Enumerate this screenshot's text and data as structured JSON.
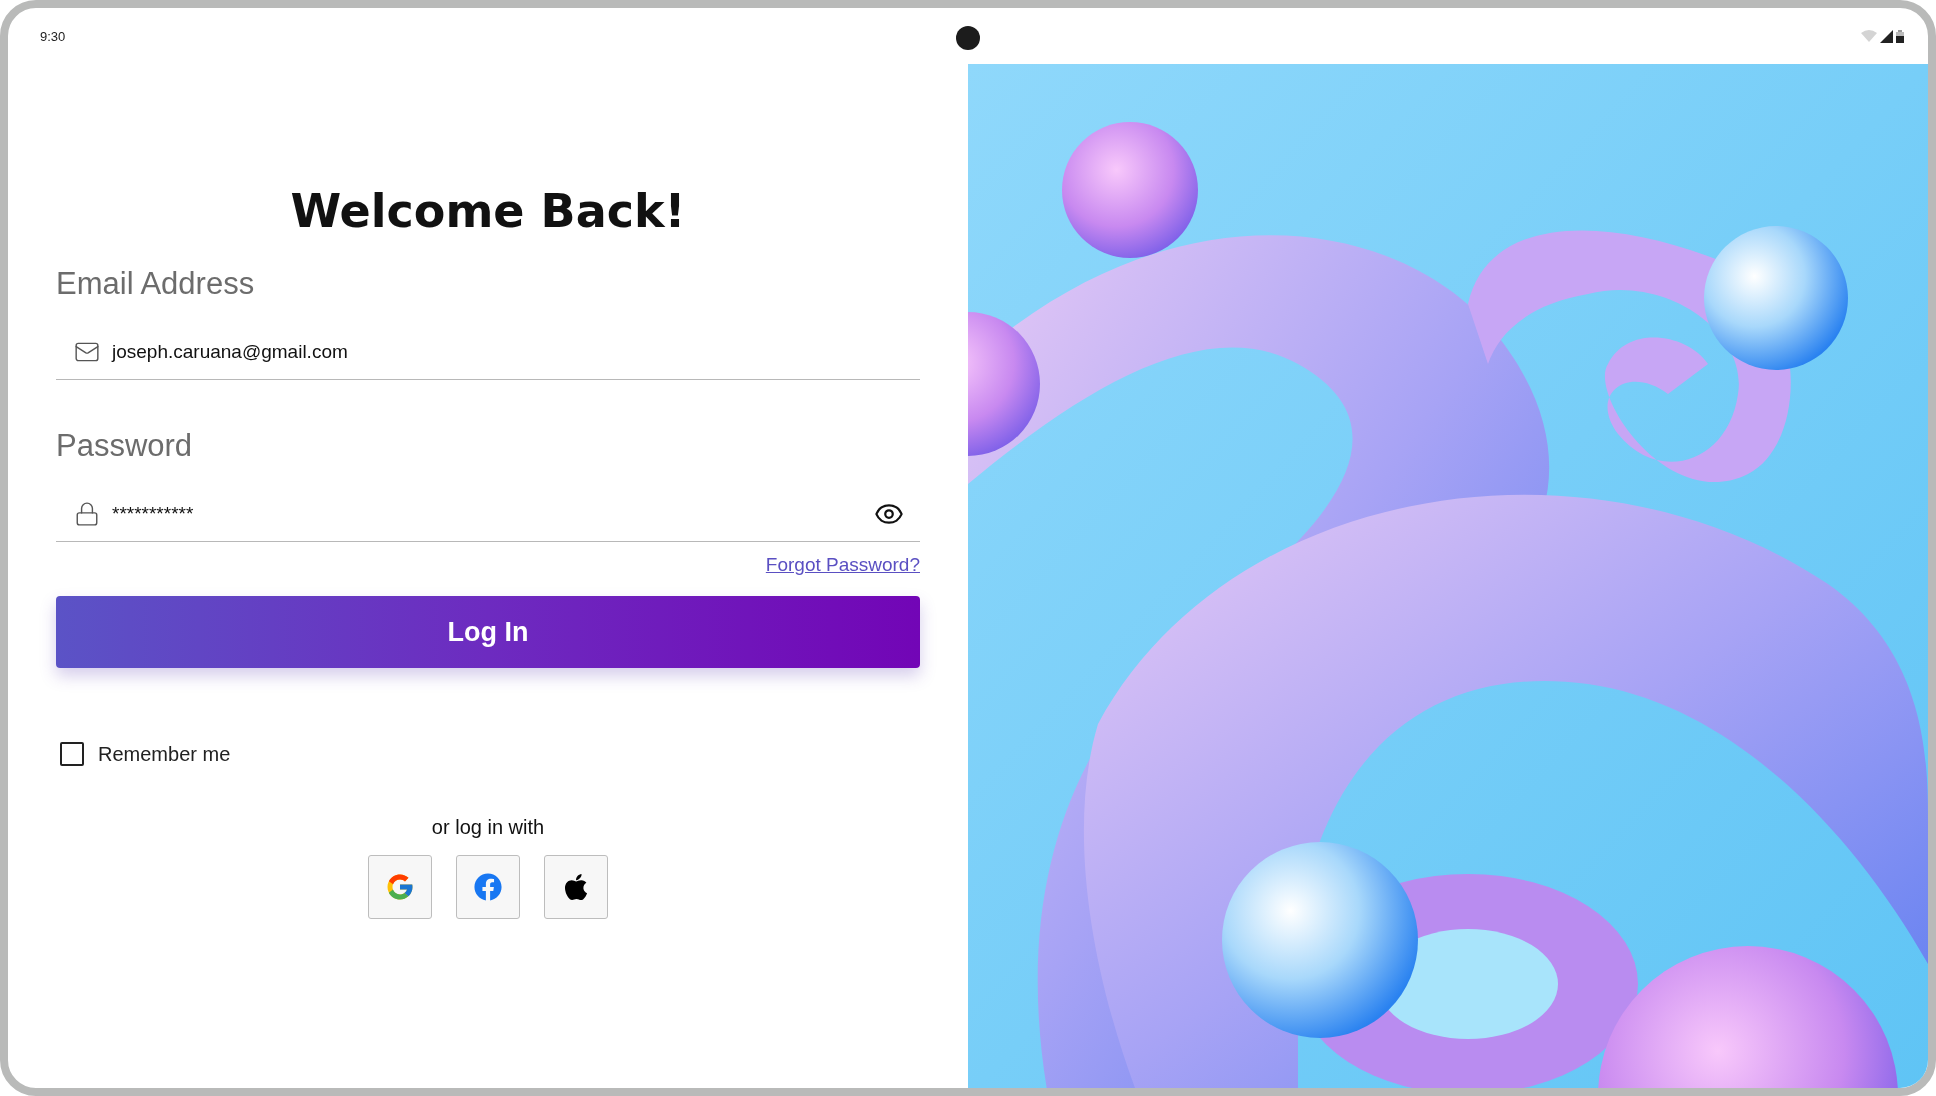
{
  "status_bar": {
    "time": "9:30"
  },
  "title": "Welcome Back!",
  "email": {
    "label": "Email Address",
    "value": "joseph.caruana@gmail.com"
  },
  "password": {
    "label": "Password",
    "value": "***********"
  },
  "forgot_link": "Forgot Password?",
  "login_button": "Log In",
  "remember": {
    "label": "Remember me",
    "checked": false
  },
  "social_prompt": "or log in with",
  "social_buttons": [
    {
      "kind": "google"
    },
    {
      "kind": "facebook"
    },
    {
      "kind": "apple"
    }
  ]
}
